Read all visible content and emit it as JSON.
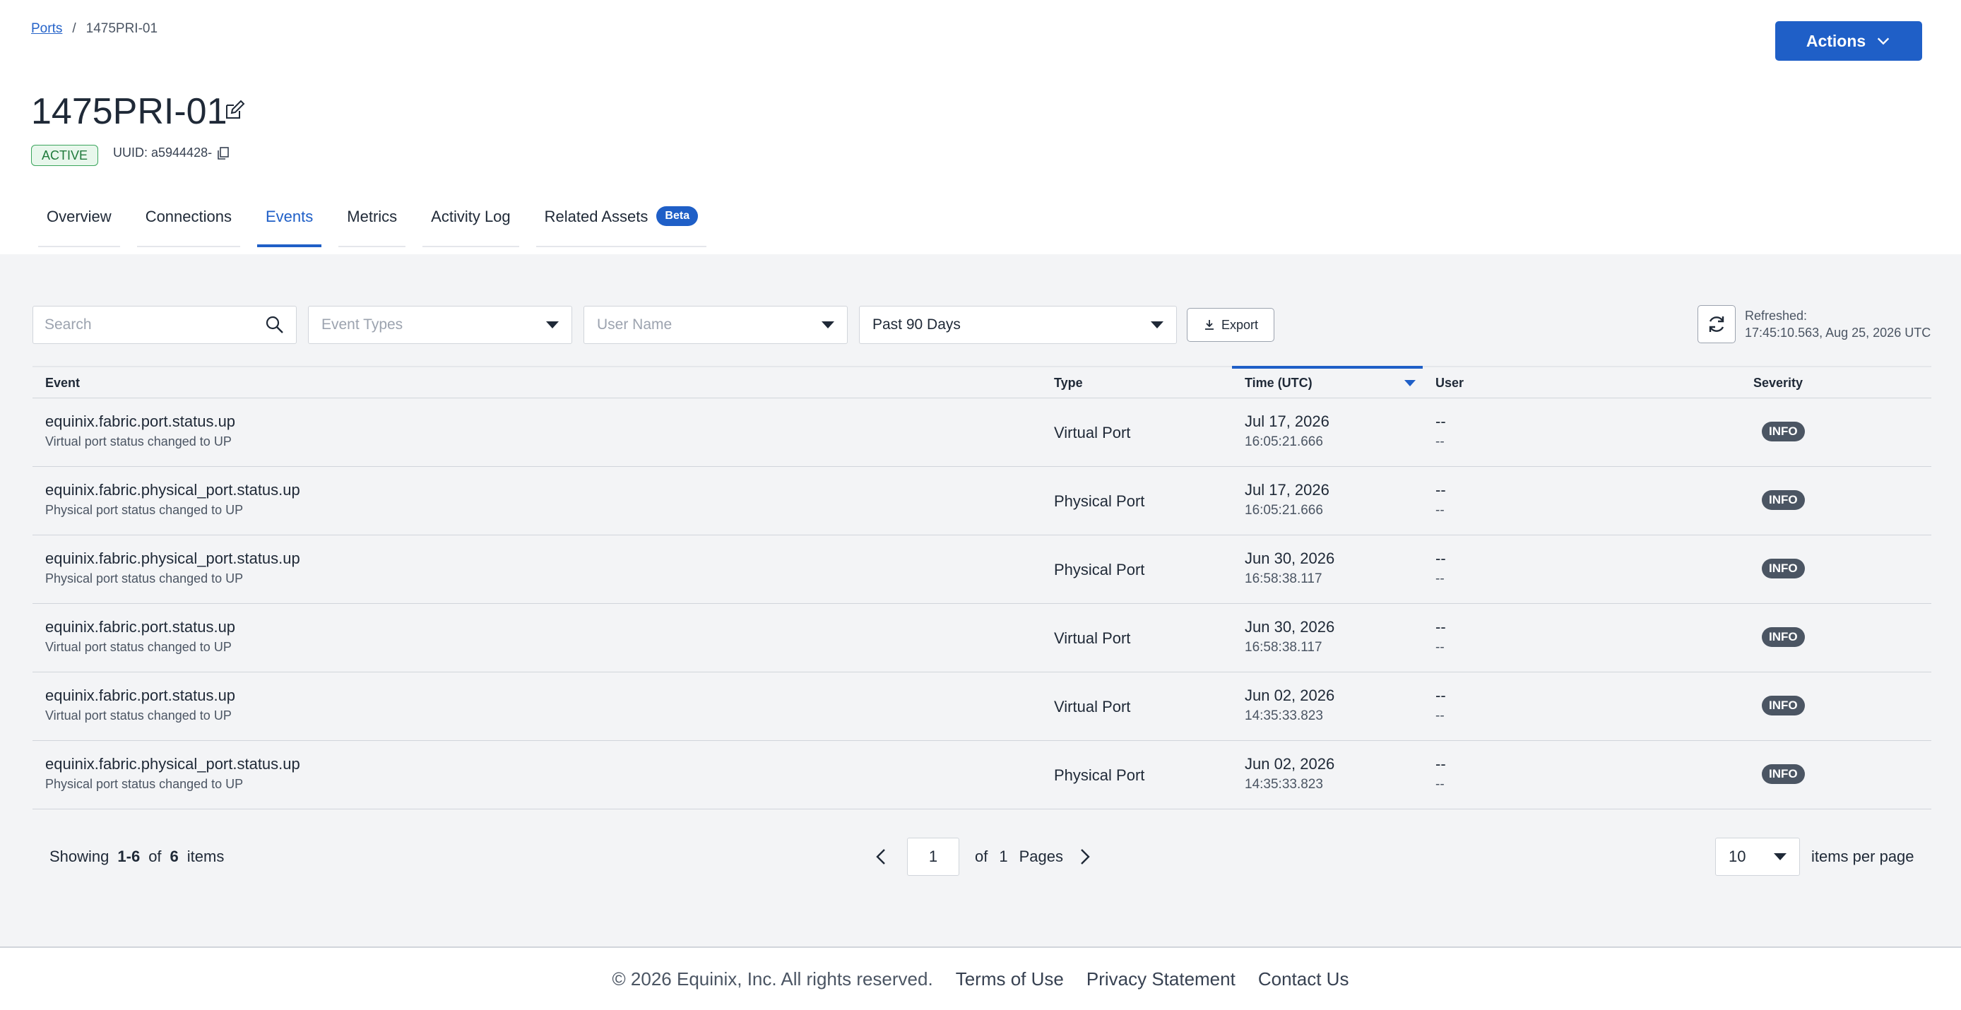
{
  "breadcrumb": {
    "parent": "Ports",
    "separator": "/",
    "current": "1475PRI-01"
  },
  "actions_label": "Actions",
  "title": "1475PRI-01",
  "status": "ACTIVE",
  "uuid": "UUID: a5944428-",
  "tabs": [
    {
      "label": "Overview"
    },
    {
      "label": "Connections"
    },
    {
      "label": "Events",
      "active": true
    },
    {
      "label": "Metrics"
    },
    {
      "label": "Activity Log"
    },
    {
      "label": "Related Assets",
      "badge": "Beta"
    }
  ],
  "filters": {
    "search_placeholder": "Search",
    "event_types_placeholder": "Event Types",
    "user_name_placeholder": "User Name",
    "date_range": "Past 90 Days",
    "export_label": "Export"
  },
  "refreshed": {
    "label": "Refreshed:",
    "value": "17:45:10.563, Aug 25, 2026 UTC"
  },
  "table": {
    "headers": {
      "event": "Event",
      "type": "Type",
      "time": "Time (UTC)",
      "user": "User",
      "severity": "Severity"
    },
    "rows": [
      {
        "event": "equinix.fabric.port.status.up",
        "desc": "Virtual port status changed to UP",
        "type": "Virtual Port",
        "date": "Jul 17, 2026",
        "time": "16:05:21.666",
        "user": "--",
        "user_sub": "--",
        "severity": "INFO"
      },
      {
        "event": "equinix.fabric.physical_port.status.up",
        "desc": "Physical port  status changed to UP",
        "type": "Physical Port",
        "date": "Jul 17, 2026",
        "time": "16:05:21.666",
        "user": "--",
        "user_sub": "--",
        "severity": "INFO"
      },
      {
        "event": "equinix.fabric.physical_port.status.up",
        "desc": "Physical port  status changed to UP",
        "type": "Physical Port",
        "date": "Jun 30, 2026",
        "time": "16:58:38.117",
        "user": "--",
        "user_sub": "--",
        "severity": "INFO"
      },
      {
        "event": "equinix.fabric.port.status.up",
        "desc": "Virtual port  status changed to UP",
        "type": "Virtual Port",
        "date": "Jun 30, 2026",
        "time": "16:58:38.117",
        "user": "--",
        "user_sub": "--",
        "severity": "INFO"
      },
      {
        "event": "equinix.fabric.port.status.up",
        "desc": "Virtual port status changed to UP",
        "type": "Virtual Port",
        "date": "Jun 02, 2026",
        "time": "14:35:33.823",
        "user": "--",
        "user_sub": "--",
        "severity": "INFO"
      },
      {
        "event": "equinix.fabric.physical_port.status.up",
        "desc": "Physical port status changed to UP",
        "type": "Physical Port",
        "date": "Jun 02, 2026",
        "time": "14:35:33.823",
        "user": "--",
        "user_sub": "--",
        "severity": "INFO"
      }
    ]
  },
  "pagination": {
    "showing_label": "Showing",
    "range": "1-6",
    "of_label": "of",
    "total": "6",
    "items_label": "items",
    "page": "1",
    "page_of": "of",
    "page_total": "1",
    "pages_label": "Pages",
    "per_page": "10",
    "per_page_label": "items per page"
  },
  "footer": {
    "copyright": "© 2026 Equinix, Inc. All rights reserved.",
    "terms": "Terms of Use",
    "privacy": "Privacy Statement",
    "contact": "Contact Us"
  },
  "colors": {
    "accent": "#1f5fc7",
    "active_badge": "#3ba55c",
    "severity_badge": "#4b5563"
  }
}
